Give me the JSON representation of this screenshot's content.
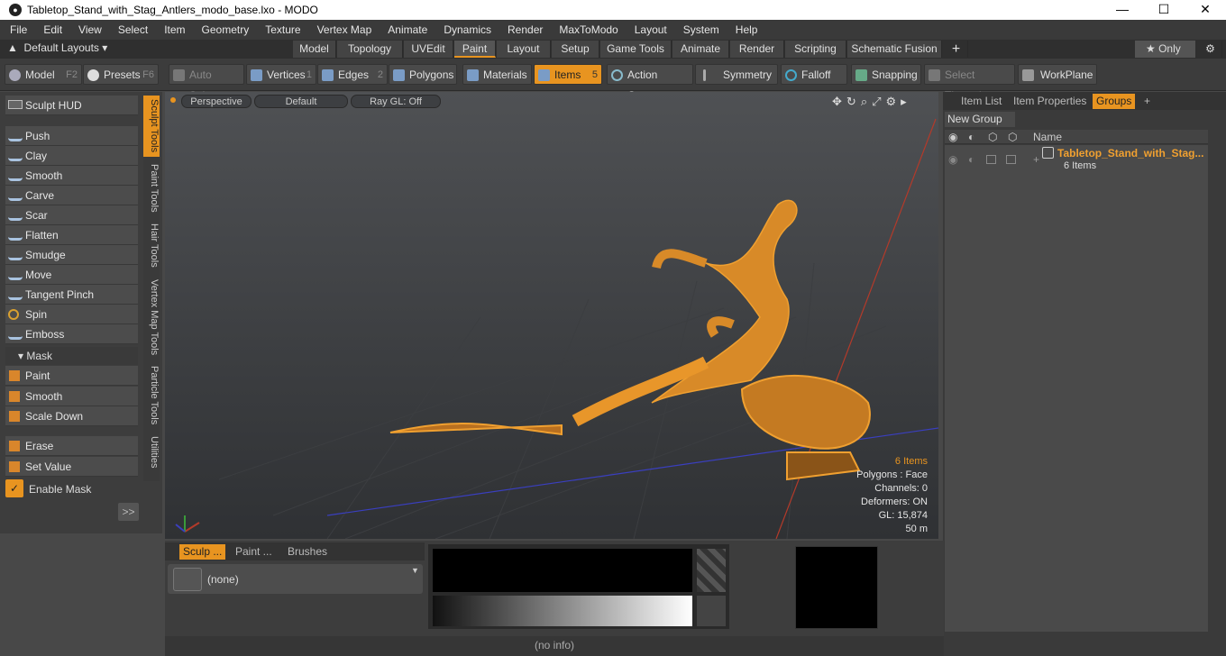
{
  "window": {
    "title": "Tabletop_Stand_with_Stag_Antlers_modo_base.lxo - MODO",
    "minimize": "—",
    "maximize": "☐",
    "close": "✕"
  },
  "menu": [
    "File",
    "Edit",
    "View",
    "Select",
    "Item",
    "Geometry",
    "Texture",
    "Vertex Map",
    "Animate",
    "Dynamics",
    "Render",
    "MaxToModo",
    "Layout",
    "System",
    "Help"
  ],
  "layout_tabs": {
    "layouts_label": "Default Layouts ▾",
    "tabs": [
      "Model",
      "Topology",
      "UVEdit",
      "Paint",
      "Layout",
      "Setup",
      "Game Tools",
      "Animate",
      "Render",
      "Scripting",
      "Schematic Fusion"
    ],
    "active": "Paint",
    "add": "+",
    "only": "★ Only",
    "gear": "⚙"
  },
  "toolbar": {
    "model": "Model",
    "model_key": "F2",
    "presets": "Presets",
    "presets_key": "F6",
    "auto_select": "Auto Select",
    "vertices": "Vertices",
    "vertices_key": "1",
    "edges": "Edges",
    "edges_key": "2",
    "polygons": "Polygons",
    "materials": "Materials",
    "items": "Items",
    "items_key": "5",
    "action_center": "Action Center",
    "symmetry": "Symmetry",
    "falloff": "Falloff",
    "snapping": "Snapping",
    "select_through": "Select Through",
    "workplane": "WorkPlane"
  },
  "left_panel": {
    "sculpt_hud": "Sculpt HUD",
    "tools": [
      "Push",
      "Clay",
      "Smooth",
      "Carve",
      "Scar",
      "Flatten",
      "Smudge",
      "Move",
      "Tangent Pinch",
      "Spin",
      "Emboss"
    ],
    "mask_label": "Mask",
    "mask_tools": [
      "Paint",
      "Smooth",
      "Scale Down"
    ],
    "erase": "Erase",
    "set_value": "Set Value",
    "enable_mask": "Enable Mask",
    "expand": ">>",
    "vertical_tabs": [
      "Sculpt Tools",
      "Paint Tools",
      "Hair Tools",
      "Vertex Map Tools",
      "Particle Tools",
      "Utilities"
    ]
  },
  "viewport": {
    "view": "Perspective",
    "shading": "Default",
    "raygl": "Ray GL: Off",
    "info": {
      "items": "6 Items",
      "polygons": "Polygons : Face",
      "channels": "Channels: 0",
      "deformers": "Deformers: ON",
      "gl": "GL: 15,874",
      "distance": "50 m"
    }
  },
  "right_panel": {
    "tabs": [
      "Item List",
      "Item Properties",
      "Groups"
    ],
    "active": "Groups",
    "add": "+",
    "new_group": "New Group",
    "name_header": "Name",
    "group_name": "Tabletop_Stand_with_Stag...",
    "group_count": "6 Items"
  },
  "bottom": {
    "tabs": [
      "Sculp ...",
      "Paint ...",
      "Brushes"
    ],
    "brush": "(none)",
    "status": "(no info)"
  },
  "colors": {
    "accent": "#e89420",
    "mesh": "#f0a030"
  }
}
